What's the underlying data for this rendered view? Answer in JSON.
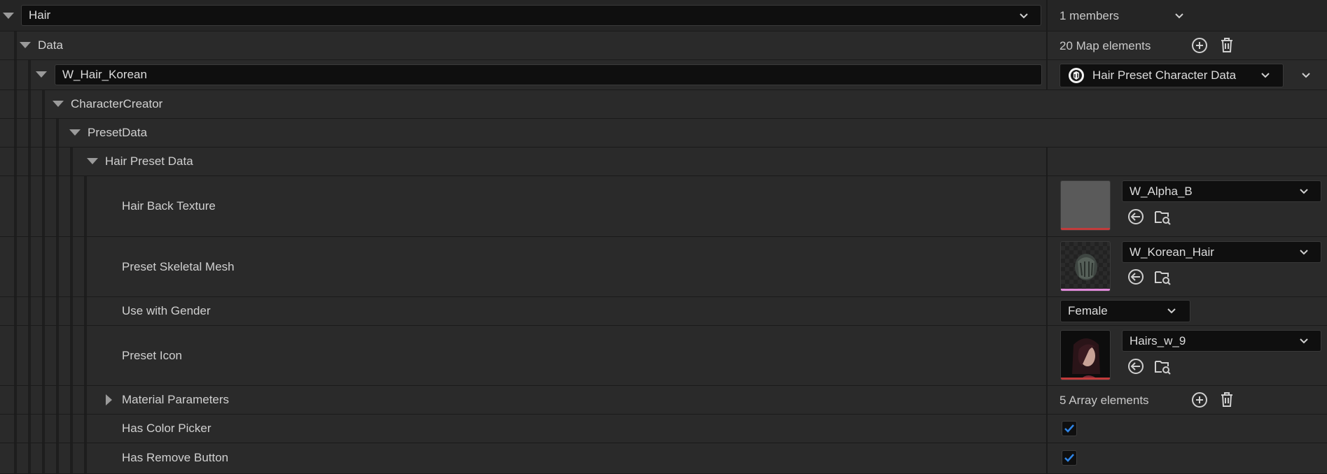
{
  "rows": {
    "hair": {
      "name_value": "Hair",
      "members": "1 members"
    },
    "data": {
      "label": "Data",
      "count": "20 Map elements"
    },
    "key": {
      "name_value": "W_Hair_Korean",
      "type_label": "Hair Preset Character Data"
    },
    "character_creator": {
      "label": "CharacterCreator"
    },
    "preset_data": {
      "label": "PresetData"
    },
    "hair_preset_data": {
      "label": "Hair Preset Data"
    },
    "hair_back_texture": {
      "label": "Hair Back Texture",
      "asset": "W_Alpha_B"
    },
    "preset_skeletal_mesh": {
      "label": "Preset Skeletal Mesh",
      "asset": "W_Korean_Hair"
    },
    "use_with_gender": {
      "label": "Use with Gender",
      "value": "Female"
    },
    "preset_icon": {
      "label": "Preset Icon",
      "asset": "Hairs_w_9"
    },
    "material_parameters": {
      "label": "Material Parameters",
      "count": "5 Array elements"
    },
    "has_color_picker": {
      "label": "Has Color Picker",
      "checked": true
    },
    "has_remove_button": {
      "label": "Has Remove Button",
      "checked": true
    }
  },
  "colors": {
    "texture_bar": "#c23b3b",
    "mesh_bar": "#e08ad9",
    "icon_bar": "#c23b3b",
    "check": "#2f86e8"
  },
  "icons": [
    "chevron-down-icon",
    "add-circle-icon",
    "trash-icon",
    "browse-back-arrow-icon",
    "folder-search-icon",
    "unreal-logo-icon",
    "checkmark-icon"
  ]
}
